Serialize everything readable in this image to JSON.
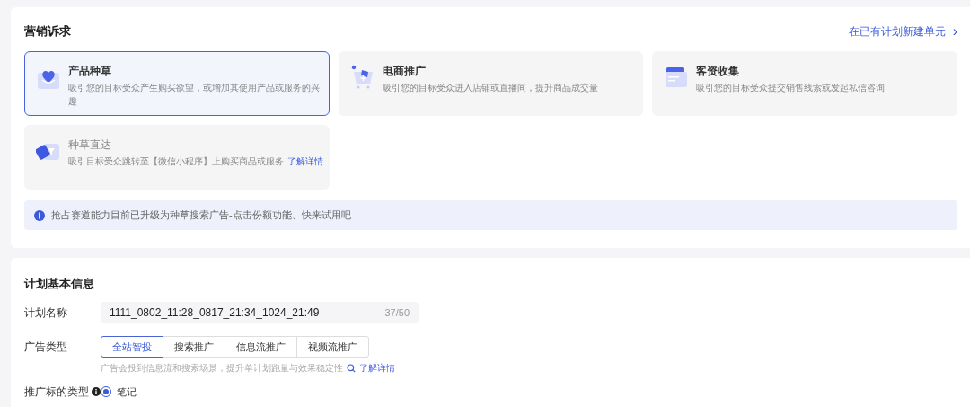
{
  "marketing": {
    "title": "营销诉求",
    "link": "在已有计划新建单元",
    "link_arrow": "›",
    "options": [
      {
        "kind": "seed",
        "title": "产品种草",
        "desc": "吸引您的目标受众产生购买欲望，或增加其使用产品或服务的兴趣",
        "selected": true,
        "disabled": false
      },
      {
        "kind": "ecommerce",
        "title": "电商推广",
        "desc": "吸引您的目标受众进入店铺或直播间，提升商品成交量",
        "selected": false,
        "disabled": false
      },
      {
        "kind": "leads",
        "title": "客资收集",
        "desc": "吸引您的目标受众提交销售线索或发起私信咨询",
        "selected": false,
        "disabled": false
      },
      {
        "kind": "direct",
        "title": "种草直达",
        "desc": "吸引目标受众跳转至【微信小程序】上购买商品或服务",
        "link": "了解详情",
        "selected": false,
        "disabled": true
      }
    ],
    "notice": "抢占赛道能力目前已升级为种草搜索广告-点击份额功能、快来试用吧"
  },
  "basic": {
    "title": "计划基本信息",
    "name_label": "计划名称",
    "name_value": "1111_0802_11:28_0817_21:34_1024_21:49",
    "name_count": "37/50",
    "type_label": "广告类型",
    "types": [
      {
        "label": "全站智投",
        "selected": true
      },
      {
        "label": "搜索推广",
        "selected": false
      },
      {
        "label": "信息流推广",
        "selected": false
      },
      {
        "label": "视频流推广",
        "selected": false
      }
    ],
    "type_hint": "广告会投到信息流和搜索场景，提升单计划跑量与效果稳定性",
    "type_hint_link": "了解详情",
    "target_label": "推广标的类型",
    "targets": [
      {
        "label": "笔记",
        "selected": true
      }
    ]
  }
}
